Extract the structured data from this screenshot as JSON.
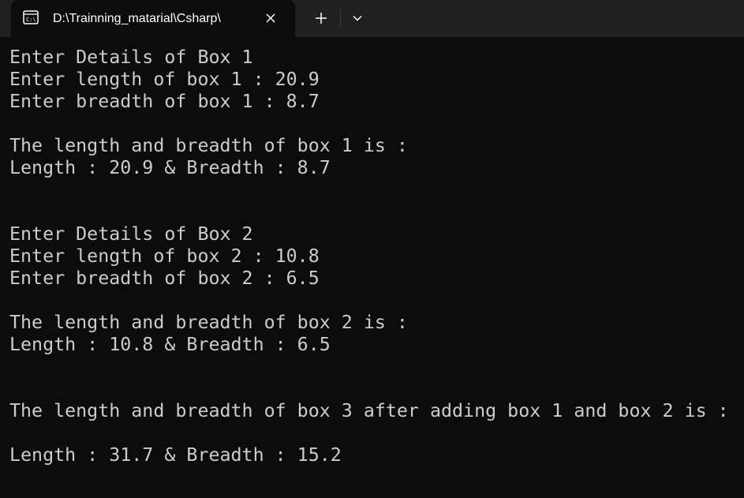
{
  "tab": {
    "title": "D:\\Trainning_matarial\\Csharp\\",
    "icon": "terminal-icon"
  },
  "toolbar": {
    "close_icon": "close-icon",
    "new_tab_icon": "plus-icon",
    "dropdown_icon": "chevron-down-icon"
  },
  "colors": {
    "background": "#0c0c0c",
    "titlebar": "#202020",
    "text": "#cccccc"
  },
  "console": {
    "lines": [
      "Enter Details of Box 1",
      "Enter length of box 1 : 20.9",
      "Enter breadth of box 1 : 8.7",
      "",
      "The length and breadth of box 1 is :",
      "Length : 20.9 & Breadth : 8.7",
      "",
      "",
      "Enter Details of Box 2",
      "Enter length of box 2 : 10.8",
      "Enter breadth of box 2 : 6.5",
      "",
      "The length and breadth of box 2 is :",
      "Length : 10.8 & Breadth : 6.5",
      "",
      "",
      "The length and breadth of box 3 after adding box 1 and box 2 is :",
      "",
      "Length : 31.7 & Breadth : 15.2"
    ]
  }
}
